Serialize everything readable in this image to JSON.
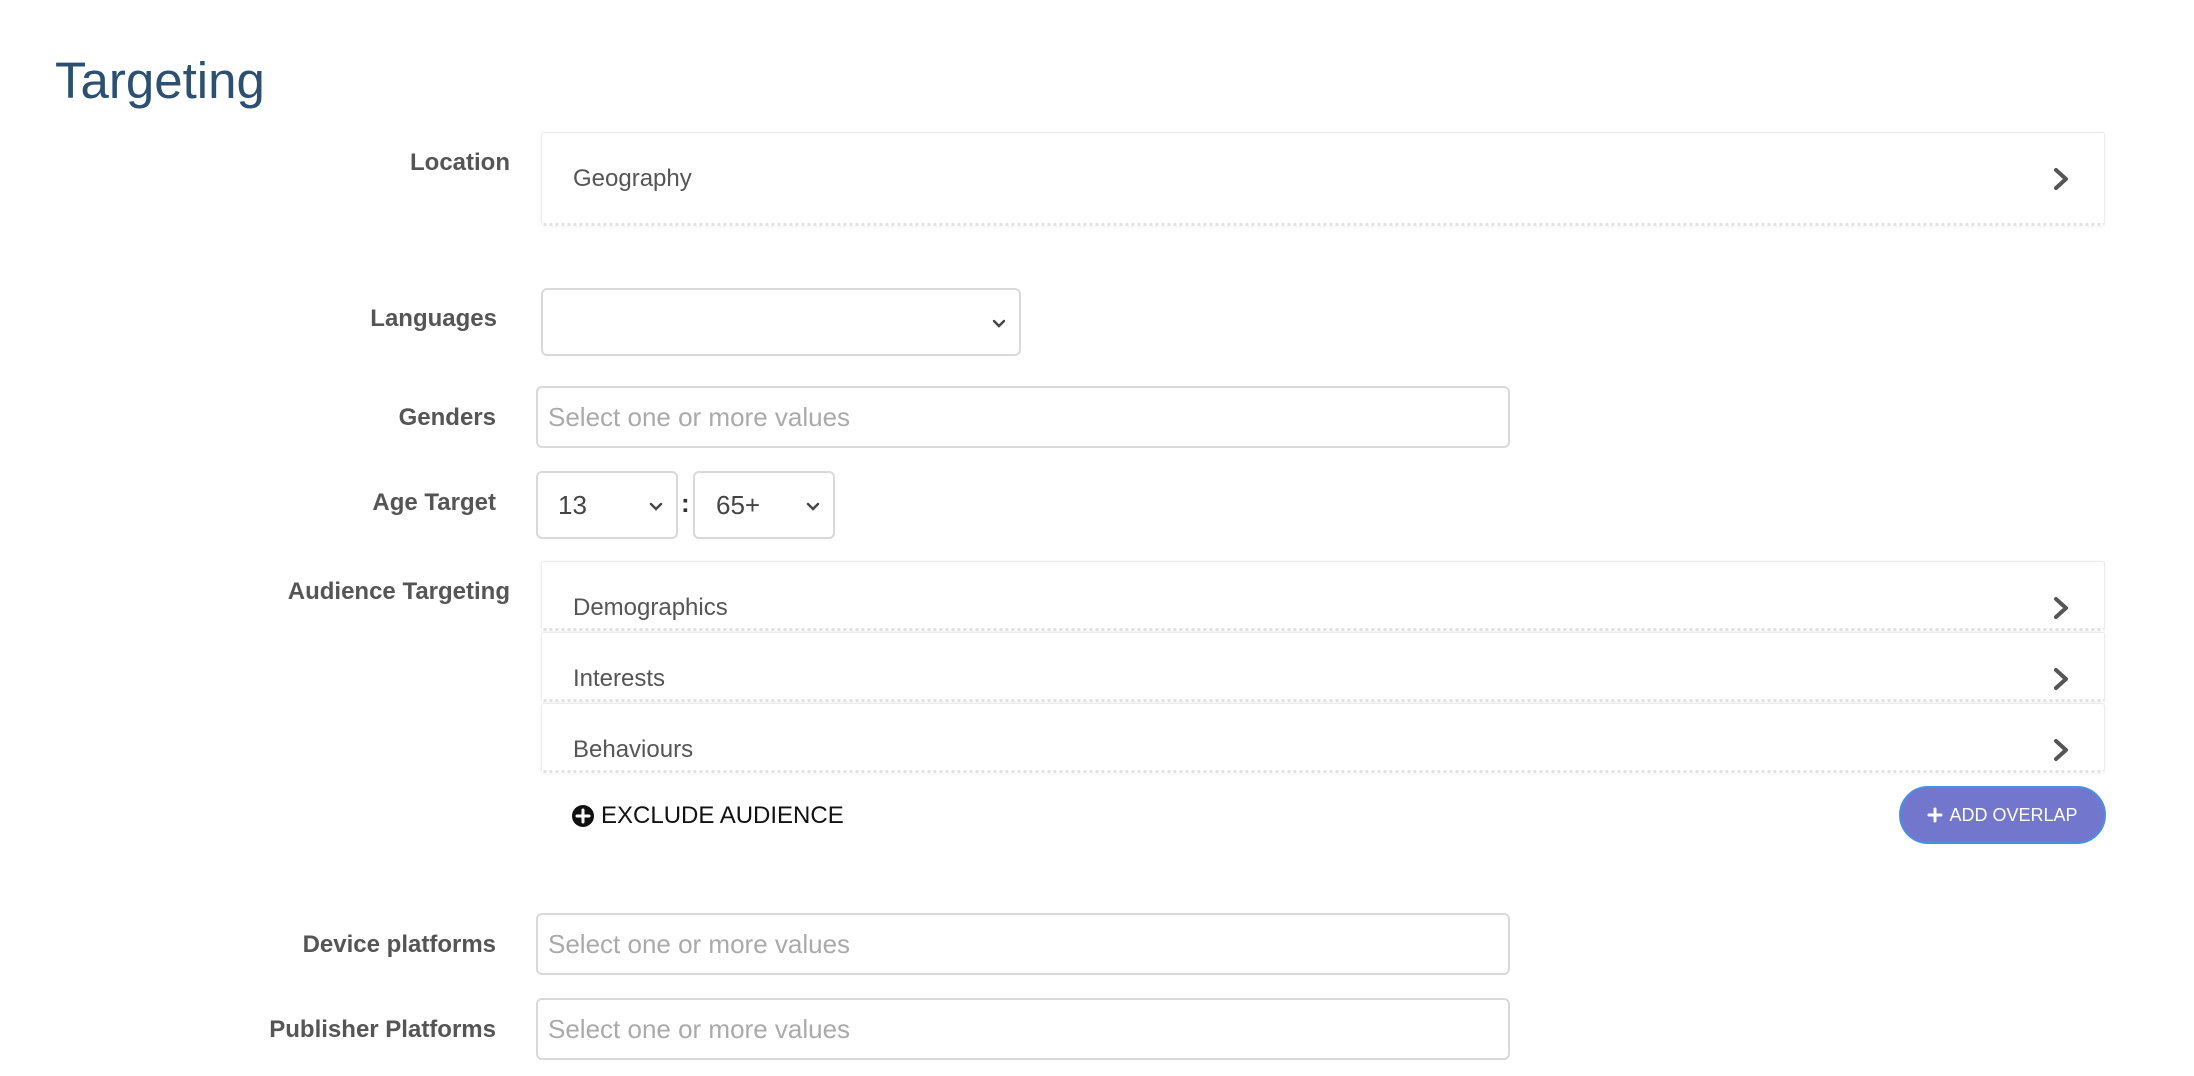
{
  "page": {
    "title": "Targeting"
  },
  "location": {
    "label": "Location",
    "panel_label": "Geography"
  },
  "languages": {
    "label": "Languages",
    "selected": ""
  },
  "genders": {
    "label": "Genders",
    "placeholder": "Select one or more values"
  },
  "age_target": {
    "label": "Age Target",
    "min": "13",
    "separator": ":",
    "max": "65+"
  },
  "audience_targeting": {
    "label": "Audience Targeting",
    "panels": [
      {
        "label": "Demographics"
      },
      {
        "label": "Interests"
      },
      {
        "label": "Behaviours"
      }
    ],
    "exclude_label": "EXCLUDE AUDIENCE",
    "add_overlap_label": "ADD OVERLAP"
  },
  "device_platforms": {
    "label": "Device platforms",
    "placeholder": "Select one or more values"
  },
  "publisher_platforms": {
    "label": "Publisher Platforms",
    "placeholder": "Select one or more values"
  },
  "colors": {
    "title": "#2d5072",
    "accent_button": "#7276cc",
    "button_border": "#4a90e2"
  },
  "icons": {
    "panel_chevron": "chevron-right-icon",
    "select_caret": "chevron-down-icon",
    "exclude": "plus-circle-icon",
    "overlap": "plus-icon"
  }
}
